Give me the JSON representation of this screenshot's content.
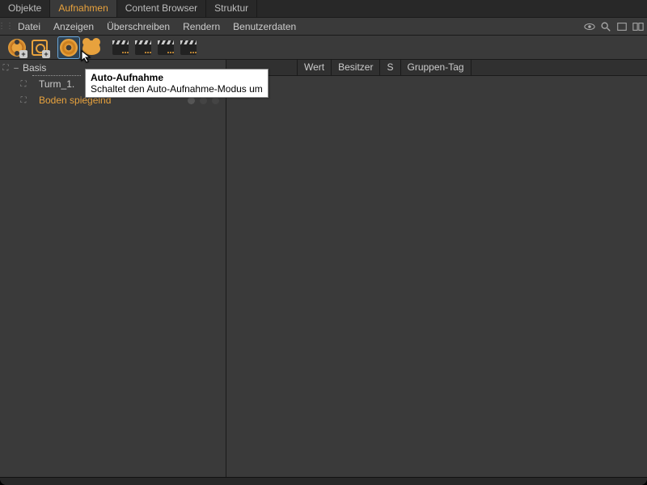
{
  "tabs": [
    {
      "label": "Objekte",
      "active": false
    },
    {
      "label": "Aufnahmen",
      "active": true
    },
    {
      "label": "Content Browser",
      "active": false
    },
    {
      "label": "Struktur",
      "active": false
    }
  ],
  "menu": {
    "items": [
      "Datei",
      "Anzeigen",
      "Überschreiben",
      "Rendern",
      "Benutzerdaten"
    ]
  },
  "toolbar": {
    "buttons": [
      {
        "name": "record-keyframe",
        "icon": "reel-plus"
      },
      {
        "name": "record-target",
        "icon": "target-plus"
      },
      {
        "name": "auto-record",
        "icon": "auto-rec",
        "selected": true
      },
      {
        "name": "keyframe-selection",
        "icon": "blob"
      },
      {
        "name": "motion-clip-1",
        "icon": "clap-dots orange"
      },
      {
        "name": "motion-clip-2",
        "icon": "clap-dots"
      },
      {
        "name": "motion-clip-3",
        "icon": "clap-dots"
      },
      {
        "name": "motion-clip-4",
        "icon": "clap-dots"
      }
    ]
  },
  "tooltip": {
    "title": "Auto-Aufnahme",
    "body": "Schaltet den Auto-Aufnahme-Modus um"
  },
  "columns": [
    "Wert",
    "Besitzer",
    "S",
    "Gruppen-Tag"
  ],
  "tree": {
    "root": {
      "label": "Basis"
    },
    "child1": {
      "label": "Turm_1."
    },
    "child2": {
      "label": "Boden spiegelnd"
    }
  }
}
